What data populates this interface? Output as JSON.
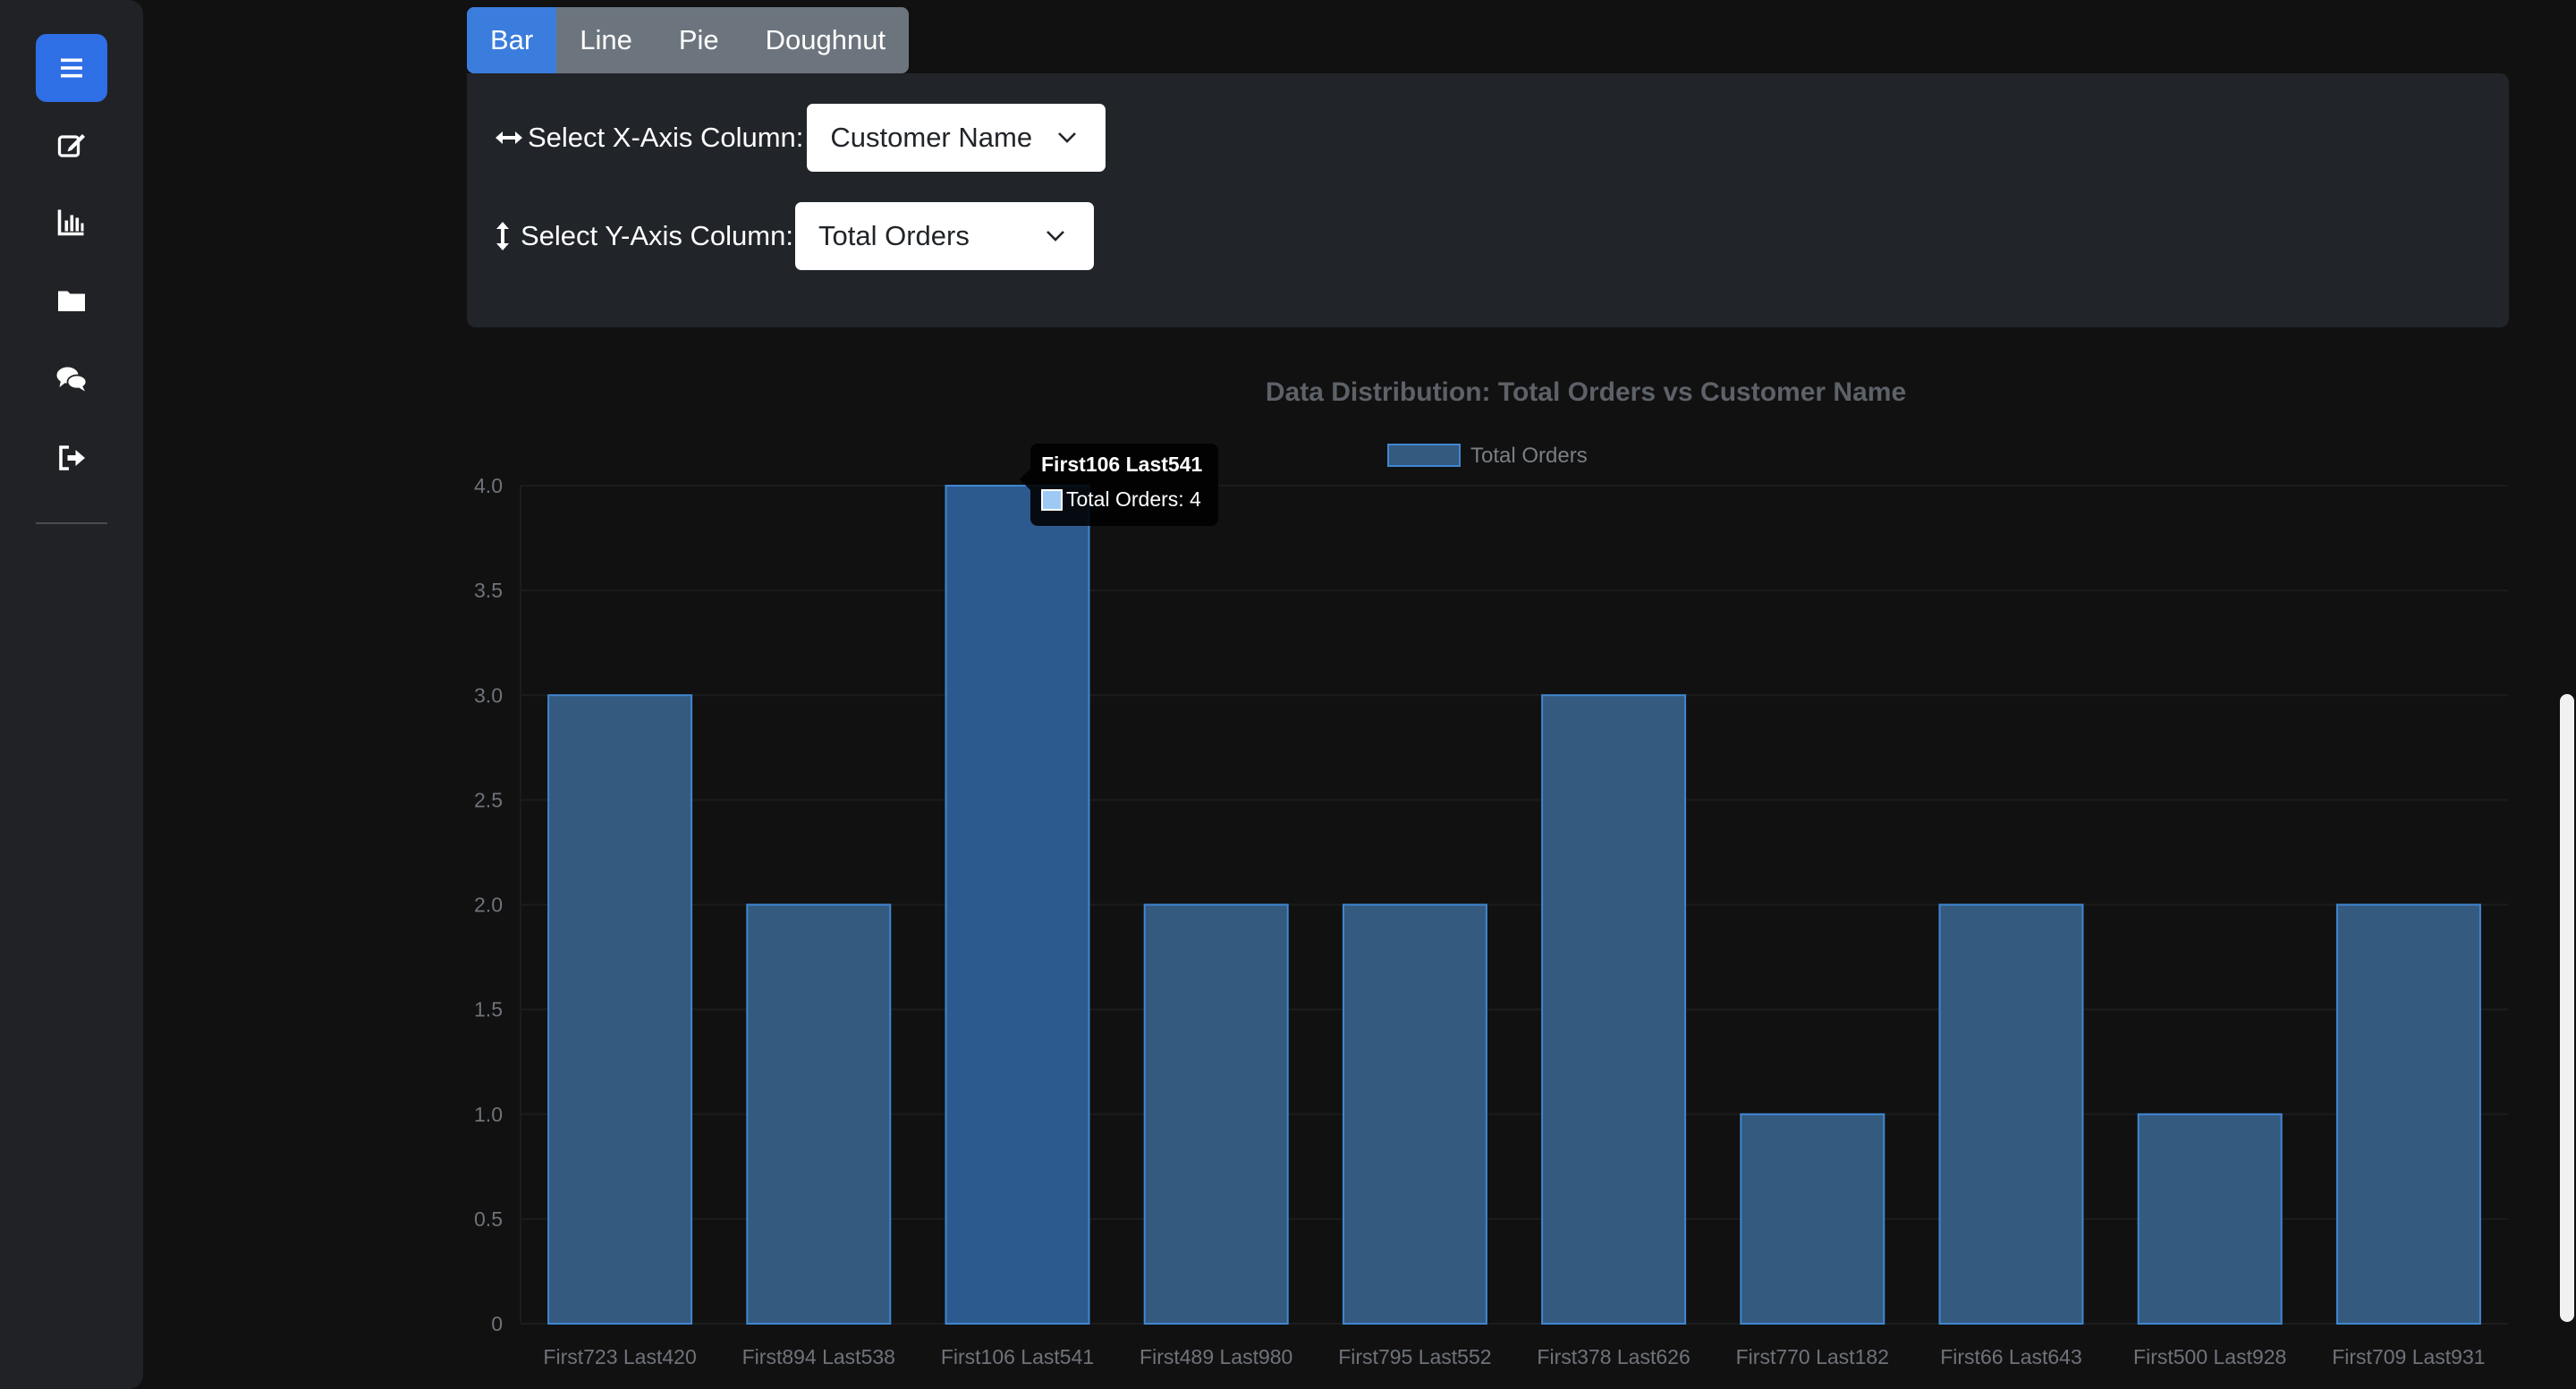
{
  "sidebar": {
    "icons": [
      "menu-icon",
      "edit-icon",
      "chart-icon",
      "folder-icon",
      "comments-icon",
      "sign-out-icon"
    ]
  },
  "tabs": [
    {
      "label": "Bar",
      "active": true
    },
    {
      "label": "Line",
      "active": false
    },
    {
      "label": "Pie",
      "active": false
    },
    {
      "label": "Doughnut",
      "active": false
    }
  ],
  "controls": {
    "x_label": "Select X-Axis Column:",
    "x_value": "Customer Name",
    "y_label": "Select Y-Axis Column:",
    "y_value": "Total Orders"
  },
  "colors": {
    "accent": "#3b7ddd",
    "bar_fill": "#345a80",
    "bar_border": "#3f87d1",
    "bar_hover": "#2d5a8e"
  },
  "tooltip": {
    "title": "First106 Last541",
    "body": "Total Orders: 4"
  },
  "chart_data": {
    "type": "bar",
    "title": "Data Distribution: Total Orders vs Customer Name",
    "xlabel": "",
    "ylabel": "",
    "categories": [
      "First723 Last420",
      "First894 Last538",
      "First106 Last541",
      "First489 Last980",
      "First795 Last552",
      "First378 Last626",
      "First770 Last182",
      "First66 Last643",
      "First500 Last928",
      "First709 Last931"
    ],
    "series": [
      {
        "name": "Total Orders",
        "values": [
          3,
          2,
          4,
          2,
          2,
          3,
          1,
          2,
          1,
          2
        ]
      }
    ],
    "ylim": [
      0,
      4
    ],
    "yticks": [
      "0",
      "0.5",
      "1.0",
      "1.5",
      "2.0",
      "2.5",
      "3.0",
      "3.5",
      "4.0"
    ],
    "highlighted_index": 2,
    "legend": "top-center",
    "grid": true
  }
}
